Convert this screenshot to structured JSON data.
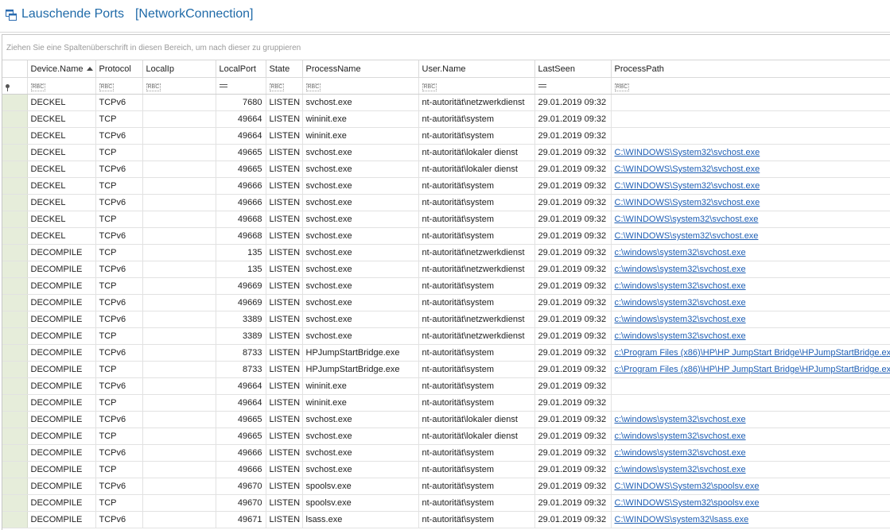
{
  "window": {
    "title": "Lauschende Ports",
    "subtitle": "[NetworkConnection]"
  },
  "grid": {
    "group_panel_hint": "Ziehen Sie eine Spaltenüberschrift in diesen Bereich, um nach dieser zu gruppieren",
    "columns": [
      {
        "key": "device",
        "label": "Device.Name",
        "sorted": "asc",
        "filter": "text"
      },
      {
        "key": "protocol",
        "label": "Protocol",
        "filter": "text"
      },
      {
        "key": "localip",
        "label": "LocalIp",
        "filter": "text"
      },
      {
        "key": "localport",
        "label": "LocalPort",
        "filter": "equals"
      },
      {
        "key": "state",
        "label": "State",
        "filter": "text"
      },
      {
        "key": "process",
        "label": "ProcessName",
        "filter": "text"
      },
      {
        "key": "user",
        "label": "User.Name",
        "filter": "text"
      },
      {
        "key": "lastseen",
        "label": "LastSeen",
        "filter": "equals"
      },
      {
        "key": "path",
        "label": "ProcessPath",
        "filter": "text"
      }
    ],
    "filter_text_icon": "RBC",
    "rows": [
      [
        "DECKEL",
        "TCPv6",
        "",
        "7680",
        "LISTEN",
        "svchost.exe",
        "nt-autorität\\netzwerkdienst",
        "29.01.2019 09:32",
        ""
      ],
      [
        "DECKEL",
        "TCP",
        "",
        "49664",
        "LISTEN",
        "wininit.exe",
        "nt-autorität\\system",
        "29.01.2019 09:32",
        ""
      ],
      [
        "DECKEL",
        "TCPv6",
        "",
        "49664",
        "LISTEN",
        "wininit.exe",
        "nt-autorität\\system",
        "29.01.2019 09:32",
        ""
      ],
      [
        "DECKEL",
        "TCP",
        "",
        "49665",
        "LISTEN",
        "svchost.exe",
        "nt-autorität\\lokaler dienst",
        "29.01.2019 09:32",
        "C:\\WINDOWS\\System32\\svchost.exe"
      ],
      [
        "DECKEL",
        "TCPv6",
        "",
        "49665",
        "LISTEN",
        "svchost.exe",
        "nt-autorität\\lokaler dienst",
        "29.01.2019 09:32",
        "C:\\WINDOWS\\System32\\svchost.exe"
      ],
      [
        "DECKEL",
        "TCP",
        "",
        "49666",
        "LISTEN",
        "svchost.exe",
        "nt-autorität\\system",
        "29.01.2019 09:32",
        "C:\\WINDOWS\\System32\\svchost.exe"
      ],
      [
        "DECKEL",
        "TCPv6",
        "",
        "49666",
        "LISTEN",
        "svchost.exe",
        "nt-autorität\\system",
        "29.01.2019 09:32",
        "C:\\WINDOWS\\System32\\svchost.exe"
      ],
      [
        "DECKEL",
        "TCP",
        "",
        "49668",
        "LISTEN",
        "svchost.exe",
        "nt-autorität\\system",
        "29.01.2019 09:32",
        "C:\\WINDOWS\\system32\\svchost.exe"
      ],
      [
        "DECKEL",
        "TCPv6",
        "",
        "49668",
        "LISTEN",
        "svchost.exe",
        "nt-autorität\\system",
        "29.01.2019 09:32",
        "C:\\WINDOWS\\system32\\svchost.exe"
      ],
      [
        "DECOMPILE",
        "TCP",
        "",
        "135",
        "LISTEN",
        "svchost.exe",
        "nt-autorität\\netzwerkdienst",
        "29.01.2019 09:32",
        "c:\\windows\\system32\\svchost.exe"
      ],
      [
        "DECOMPILE",
        "TCPv6",
        "",
        "135",
        "LISTEN",
        "svchost.exe",
        "nt-autorität\\netzwerkdienst",
        "29.01.2019 09:32",
        "c:\\windows\\system32\\svchost.exe"
      ],
      [
        "DECOMPILE",
        "TCP",
        "",
        "49669",
        "LISTEN",
        "svchost.exe",
        "nt-autorität\\system",
        "29.01.2019 09:32",
        "c:\\windows\\system32\\svchost.exe"
      ],
      [
        "DECOMPILE",
        "TCPv6",
        "",
        "49669",
        "LISTEN",
        "svchost.exe",
        "nt-autorität\\system",
        "29.01.2019 09:32",
        "c:\\windows\\system32\\svchost.exe"
      ],
      [
        "DECOMPILE",
        "TCPv6",
        "",
        "3389",
        "LISTEN",
        "svchost.exe",
        "nt-autorität\\netzwerkdienst",
        "29.01.2019 09:32",
        "c:\\windows\\system32\\svchost.exe"
      ],
      [
        "DECOMPILE",
        "TCP",
        "",
        "3389",
        "LISTEN",
        "svchost.exe",
        "nt-autorität\\netzwerkdienst",
        "29.01.2019 09:32",
        "c:\\windows\\system32\\svchost.exe"
      ],
      [
        "DECOMPILE",
        "TCPv6",
        "",
        "8733",
        "LISTEN",
        "HPJumpStartBridge.exe",
        "nt-autorität\\system",
        "29.01.2019 09:32",
        "c:\\Program Files (x86)\\HP\\HP JumpStart Bridge\\HPJumpStartBridge.exe"
      ],
      [
        "DECOMPILE",
        "TCP",
        "",
        "8733",
        "LISTEN",
        "HPJumpStartBridge.exe",
        "nt-autorität\\system",
        "29.01.2019 09:32",
        "c:\\Program Files (x86)\\HP\\HP JumpStart Bridge\\HPJumpStartBridge.exe"
      ],
      [
        "DECOMPILE",
        "TCPv6",
        "",
        "49664",
        "LISTEN",
        "wininit.exe",
        "nt-autorität\\system",
        "29.01.2019 09:32",
        ""
      ],
      [
        "DECOMPILE",
        "TCP",
        "",
        "49664",
        "LISTEN",
        "wininit.exe",
        "nt-autorität\\system",
        "29.01.2019 09:32",
        ""
      ],
      [
        "DECOMPILE",
        "TCPv6",
        "",
        "49665",
        "LISTEN",
        "svchost.exe",
        "nt-autorität\\lokaler dienst",
        "29.01.2019 09:32",
        "c:\\windows\\system32\\svchost.exe"
      ],
      [
        "DECOMPILE",
        "TCP",
        "",
        "49665",
        "LISTEN",
        "svchost.exe",
        "nt-autorität\\lokaler dienst",
        "29.01.2019 09:32",
        "c:\\windows\\system32\\svchost.exe"
      ],
      [
        "DECOMPILE",
        "TCPv6",
        "",
        "49666",
        "LISTEN",
        "svchost.exe",
        "nt-autorität\\system",
        "29.01.2019 09:32",
        "c:\\windows\\system32\\svchost.exe"
      ],
      [
        "DECOMPILE",
        "TCP",
        "",
        "49666",
        "LISTEN",
        "svchost.exe",
        "nt-autorität\\system",
        "29.01.2019 09:32",
        "c:\\windows\\system32\\svchost.exe"
      ],
      [
        "DECOMPILE",
        "TCPv6",
        "",
        "49670",
        "LISTEN",
        "spoolsv.exe",
        "nt-autorität\\system",
        "29.01.2019 09:32",
        "C:\\WINDOWS\\System32\\spoolsv.exe"
      ],
      [
        "DECOMPILE",
        "TCP",
        "",
        "49670",
        "LISTEN",
        "spoolsv.exe",
        "nt-autorität\\system",
        "29.01.2019 09:32",
        "C:\\WINDOWS\\System32\\spoolsv.exe"
      ],
      [
        "DECOMPILE",
        "TCPv6",
        "",
        "49671",
        "LISTEN",
        "lsass.exe",
        "nt-autorität\\system",
        "29.01.2019 09:32",
        "C:\\WINDOWS\\system32\\lsass.exe"
      ]
    ]
  },
  "colors": {
    "title": "#1f6aa8",
    "link": "#1f5fb4",
    "indicator": "#e6edda"
  },
  "icons": {
    "title": "network-window-icon",
    "sort": "sort-ascending-icon",
    "filter_row": "pin-icon"
  }
}
